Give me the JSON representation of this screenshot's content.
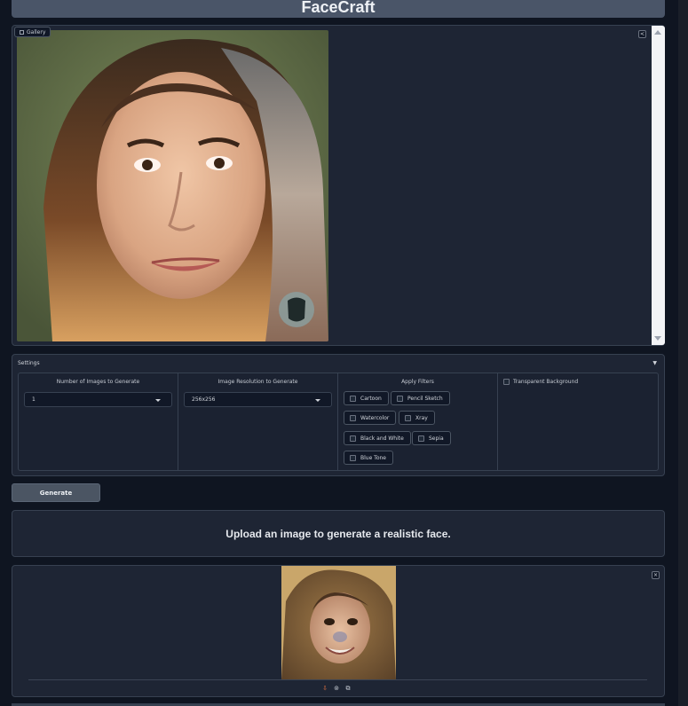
{
  "app": {
    "title": "FaceCraft"
  },
  "gallery": {
    "label": "Gallery"
  },
  "settings": {
    "title": "Settings",
    "toggle_icon": "▼",
    "num_images": {
      "label": "Number of Images to Generate",
      "value": "1"
    },
    "resolution": {
      "label": "Image Resolution to Generate",
      "value": "256x256"
    },
    "filters": {
      "label": "Apply Filters",
      "options": [
        "Cartoon",
        "Pencil Sketch",
        "Watercolor",
        "Xray",
        "Black and White",
        "Sepia",
        "Blue Tone"
      ]
    },
    "transparent_label": "Transparent Background"
  },
  "generate_label": "Generate",
  "message": "Upload an image to generate a realistic face.",
  "colors": {
    "accent": "#4b5563",
    "panel": "#1e2534",
    "background": "#0f1521"
  }
}
